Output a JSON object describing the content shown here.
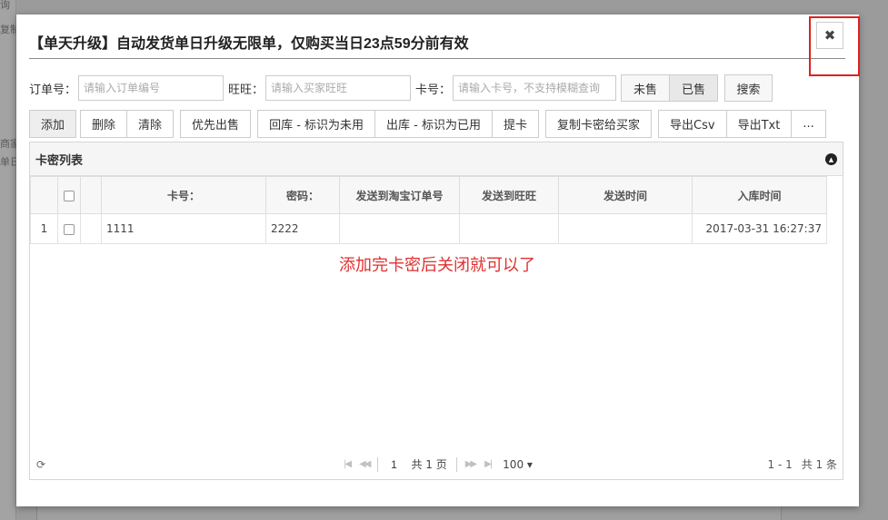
{
  "background": {
    "cells": [
      "询",
      "复制",
      "商家",
      "单日"
    ]
  },
  "dialog": {
    "title": "【单天升级】自动发货单日升级无限单，仅购买当日23点59分前有效",
    "close_glyph": "✖"
  },
  "search": {
    "order_label": "订单号：",
    "order_placeholder": "请输入订单编号",
    "wangwang_label": "旺旺：",
    "wangwang_placeholder": "请输入买家旺旺",
    "card_label": "卡号：",
    "card_placeholder": "请输入卡号，不支持模糊查询",
    "unsold_label": "未售",
    "sold_label": "已售",
    "search_label": "搜索"
  },
  "toolbar": {
    "add": "添加",
    "delete": "删除",
    "clear": "清除",
    "priority_sell": "优先出售",
    "return_unused": "回库 - 标识为未用",
    "out_used": "出库 - 标识为已用",
    "extract": "提卡",
    "copy_to_buyer": "复制卡密给买家",
    "export_csv": "导出Csv",
    "export_txt": "导出Txt",
    "more": "..."
  },
  "grid": {
    "title": "卡密列表",
    "columns": [
      "卡号：",
      "密码：",
      "发送到淘宝订单号",
      "发送到旺旺",
      "发送时间",
      "入库时间"
    ],
    "rows": [
      {
        "index": "1",
        "card": "1111",
        "password": "2222",
        "taobao_order": "",
        "wangwang": "",
        "send_time": "",
        "stock_time": "2017-03-31 16:27:37"
      }
    ],
    "annotation": "添加完卡密后关闭就可以了"
  },
  "pager": {
    "first": "|◀",
    "prev": "◀◀",
    "page_value": "1",
    "total_pages": "共 1 页",
    "next": "▶▶",
    "last": "▶|",
    "page_size": "100 ▾",
    "range": "1 - 1",
    "total_count": "共 1 条"
  },
  "colors": {
    "highlight": "#e02020",
    "annotation": "#e03030"
  }
}
